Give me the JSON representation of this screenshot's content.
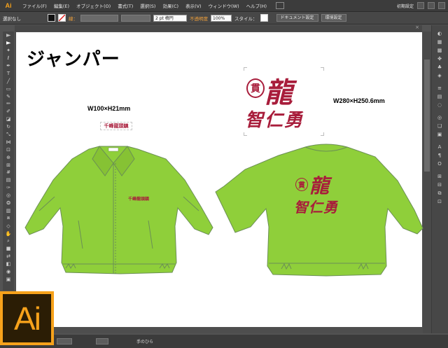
{
  "app": {
    "logo": "Ai",
    "menus": [
      "ファイル(F)",
      "編集(E)",
      "オブジェクト(O)",
      "書式(T)",
      "選択(S)",
      "効果(C)",
      "表示(V)",
      "ウィンドウ(W)",
      "ヘルプ(H)"
    ],
    "workspace": "初期設定"
  },
  "controlbar": {
    "selection": "選択なし",
    "stroke_label": "線：",
    "stroke_weight": "2 pt 楕円",
    "opacity_label": "不透明度",
    "opacity_value": "100%",
    "style_label": "スタイル：",
    "doc_settings": "ドキュメント設定",
    "prefs": "環境設定"
  },
  "artboard": {
    "title": "ジャンパー",
    "left_size": "W100×H21mm",
    "right_size": "W280×H250.6mm",
    "badge_text": "千峰龍頭鎮",
    "chest_text": "千峰龍頭鎮",
    "logo_big": "龍",
    "logo_small": "貫",
    "logo_motto": "智仁勇"
  },
  "statusbar": {
    "tool": "手のひら"
  },
  "colors": {
    "jacket": "#8fcf3a",
    "emblem": "#a81d3b",
    "ai_orange": "#f7a21b"
  }
}
